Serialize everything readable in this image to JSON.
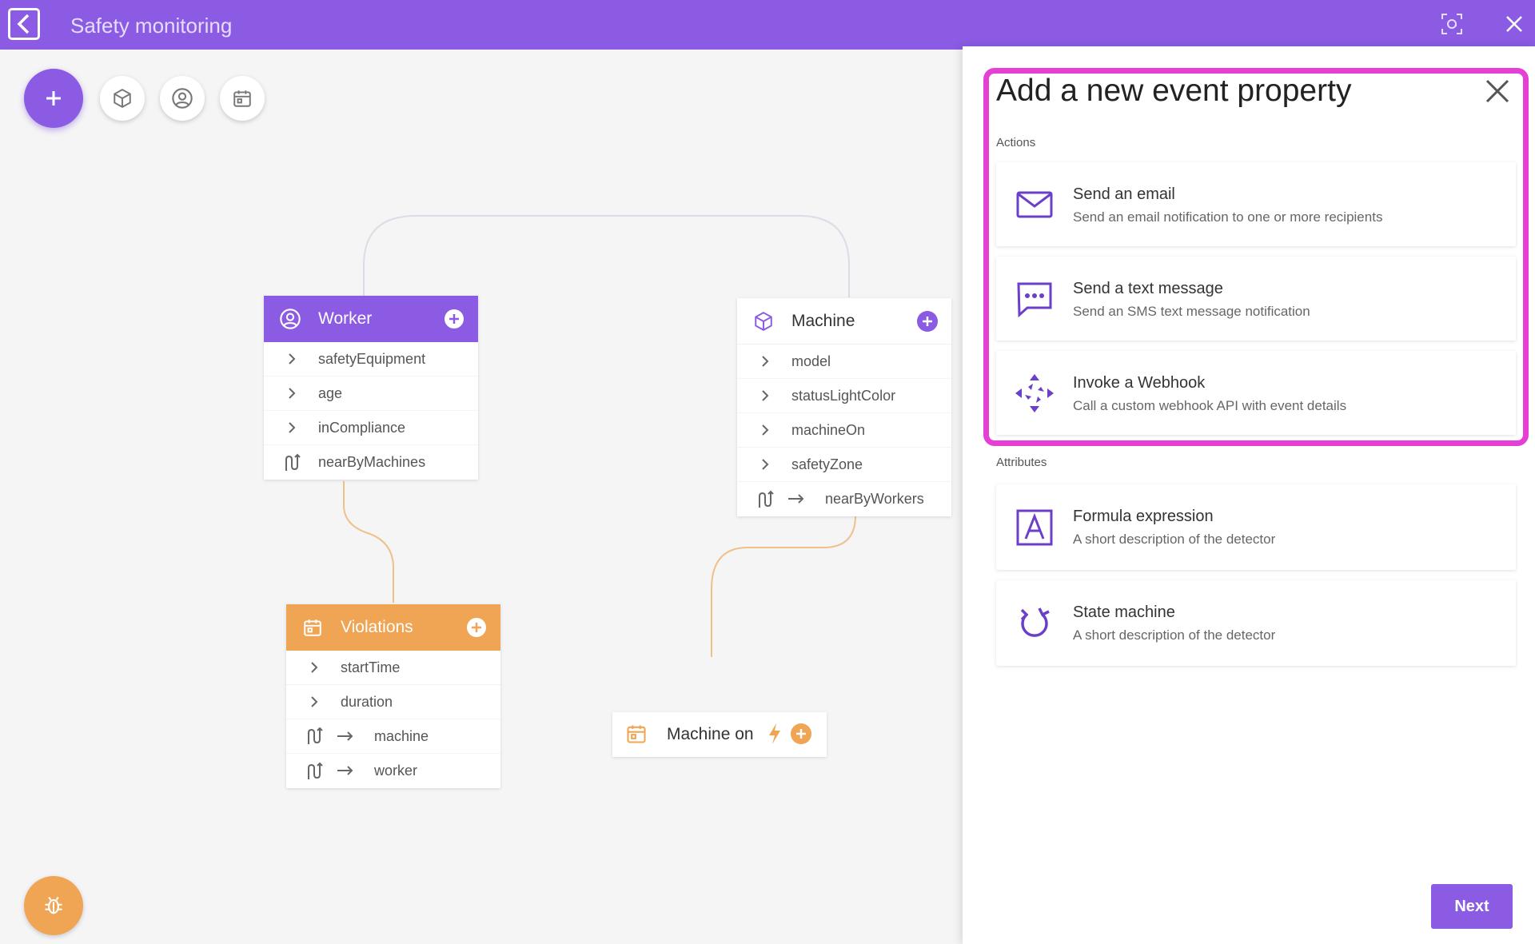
{
  "app": {
    "title": "Safety monitoring"
  },
  "toolbar": {
    "add_icon": "plus-icon",
    "entity_icon": "cube-icon",
    "person_icon": "person-circle-icon",
    "event_icon": "calendar-icon"
  },
  "nodes": {
    "worker": {
      "title": "Worker",
      "properties": [
        {
          "label": "safetyEquipment",
          "kind": "attribute"
        },
        {
          "label": "age",
          "kind": "attribute"
        },
        {
          "label": "inCompliance",
          "kind": "attribute"
        },
        {
          "label": "nearByMachines",
          "kind": "relationship"
        }
      ]
    },
    "machine": {
      "title": "Machine",
      "properties": [
        {
          "label": "model",
          "kind": "attribute"
        },
        {
          "label": "statusLightColor",
          "kind": "attribute"
        },
        {
          "label": "machineOn",
          "kind": "attribute"
        },
        {
          "label": "safetyZone",
          "kind": "attribute"
        },
        {
          "label": "nearByWorkers",
          "kind": "relationship"
        }
      ]
    },
    "violations": {
      "title": "Violations",
      "properties": [
        {
          "label": "startTime",
          "kind": "attribute"
        },
        {
          "label": "duration",
          "kind": "attribute"
        },
        {
          "label": "machine",
          "kind": "relationship"
        },
        {
          "label": "worker",
          "kind": "relationship"
        }
      ]
    },
    "machine_on": {
      "title": "Machine on"
    }
  },
  "panel": {
    "title": "Add a new event property",
    "actions_label": "Actions",
    "actions": [
      {
        "title": "Send an email",
        "description": "Send an email notification to one or more recipients",
        "icon": "envelope-icon"
      },
      {
        "title": "Send a text message",
        "description": "Send an SMS text message notification",
        "icon": "chat-bubble-icon"
      },
      {
        "title": "Invoke a Webhook",
        "description": "Call a custom webhook API with event details",
        "icon": "webhook-icon"
      }
    ],
    "attributes_label": "Attributes",
    "attributes": [
      {
        "title": "Formula expression",
        "description": "A short description of the detector",
        "icon": "formula-icon"
      },
      {
        "title": "State machine",
        "description": "A short description of the detector",
        "icon": "cycle-icon"
      }
    ],
    "next_label": "Next"
  },
  "colors": {
    "purple": "#8b5be3",
    "orange": "#f0a555",
    "highlight": "#e53fd5"
  }
}
